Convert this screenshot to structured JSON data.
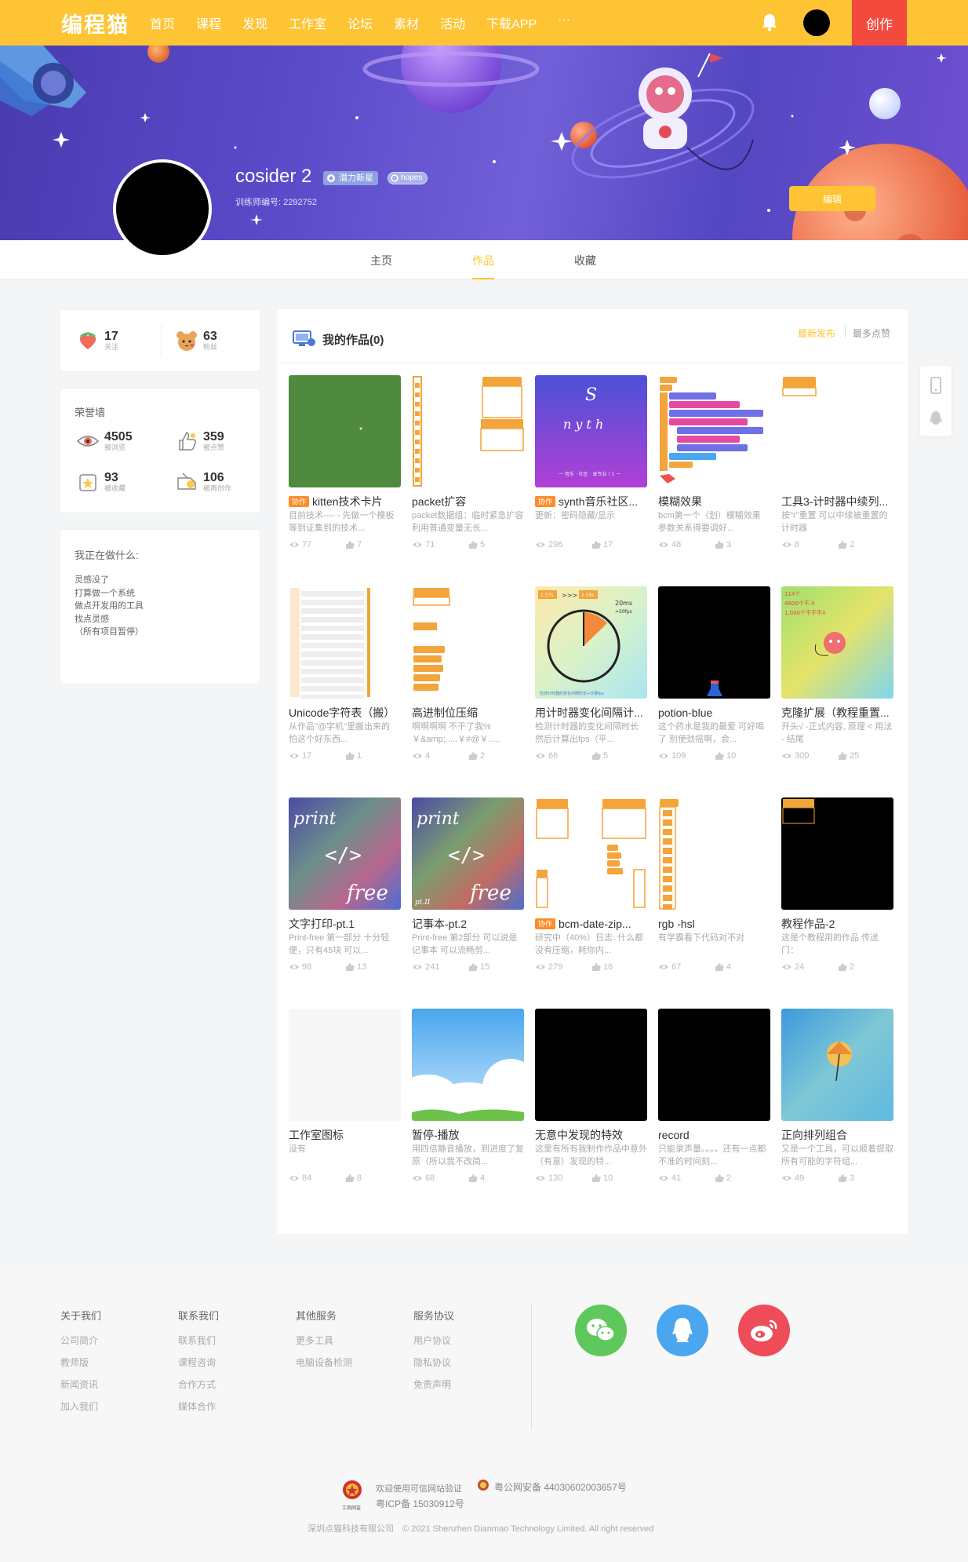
{
  "nav": {
    "logo": "编程猫",
    "links": [
      "首页",
      "课程",
      "发现",
      "工作室",
      "论坛",
      "素材",
      "活动",
      "下载APP",
      "···"
    ],
    "create": "创作",
    "bell_icon": "bell-icon"
  },
  "profile": {
    "name": "cosider 2",
    "badge": "潜力新星",
    "badge2": "hopes",
    "id_label": "训练师编号: 2292752",
    "edit": "编辑"
  },
  "tabs": [
    "主页",
    "作品",
    "收藏"
  ],
  "active_tab": "作品",
  "stats": {
    "follow": {
      "num": "17",
      "label": "关注"
    },
    "fans": {
      "num": "63",
      "label": "粉丝"
    }
  },
  "honor": {
    "title": "荣誉墙",
    "items": [
      {
        "num": "4505",
        "label": "被浏览"
      },
      {
        "num": "359",
        "label": "被点赞"
      },
      {
        "num": "93",
        "label": "被收藏"
      },
      {
        "num": "106",
        "label": "被再创作"
      }
    ]
  },
  "doing": {
    "title": "我正在做什么:",
    "text": "灵感没了\n打算做一个系统\n做点开发用的工具\n找点灵感\n（所有项目暂停）"
  },
  "works": {
    "title": "我的作品(0)",
    "sort_new": "最新发布",
    "sort_hot": "最多点赞",
    "items": [
      {
        "title": "kitten技术卡片",
        "tag": "协作",
        "desc": "目前技术---- - 先做一个模板 等到证集到的技术...",
        "views": "77",
        "likes": "7"
      },
      {
        "title": "packet扩容",
        "tag": "",
        "desc": "packet数据组：临时紧急扩容 利用普通变量无长...",
        "views": "71",
        "likes": "5"
      },
      {
        "title": "synth音乐社区...",
        "tag": "协作",
        "desc": "更新：密码隐藏/显示",
        "views": "296",
        "likes": "17"
      },
      {
        "title": "模糊效果",
        "tag": "",
        "desc": "bcm第一个（划）模糊效果 参数关系得要调好...",
        "views": "48",
        "likes": "3"
      },
      {
        "title": "工具3-计时器中续列...",
        "tag": "",
        "desc": "按\"r\"重置 可以中续被重置的计时器",
        "views": "8",
        "likes": "2"
      },
      {
        "title": "Unicode字符表（搬）",
        "tag": "",
        "desc": "从作品\"@字机\"里搬出来的 怕这个好东西...",
        "views": "17",
        "likes": "1"
      },
      {
        "title": "高进制位压缩",
        "tag": "",
        "desc": "啊啊啊啊 不干了我% ￥&amp;.....￥#@￥.....",
        "views": "4",
        "likes": "2"
      },
      {
        "title": "用计时器变化间隔计...",
        "tag": "",
        "desc": "检测计时器的变化间隔时长 然后计算出fps（平...",
        "views": "66",
        "likes": "5"
      },
      {
        "title": "potion-blue",
        "tag": "",
        "desc": "这个药水是我的最爱 可好喝了 别使劲摇啊，会...",
        "views": "109",
        "likes": "10"
      },
      {
        "title": "克隆扩展（教程重置...",
        "tag": "",
        "desc": "开头√ -正式内容, 原理 < 用法 - 结尾",
        "views": "300",
        "likes": "25"
      },
      {
        "title": "文字打印-pt.1",
        "tag": "",
        "desc": "Print-free 第一部分 十分轻便，只有45块 可以...",
        "views": "98",
        "likes": "13"
      },
      {
        "title": "记事本-pt.2",
        "tag": "",
        "desc": "Print-free 第2部分 可以说是记事本 可以流畅剪...",
        "views": "241",
        "likes": "15"
      },
      {
        "title": "bcm-date-zip...",
        "tag": "协作",
        "desc": "研究中（40%）日志: 什么都没有压缩，耗你内...",
        "views": "279",
        "likes": "16"
      },
      {
        "title": "rgb -hsl",
        "tag": "",
        "desc": "有学霸看下代码对不对",
        "views": "67",
        "likes": "4"
      },
      {
        "title": "教程作品-2",
        "tag": "",
        "desc": "这是个教程用的作品 传送门：",
        "views": "24",
        "likes": "2"
      },
      {
        "title": "工作室图标",
        "tag": "",
        "desc": "没有",
        "views": "84",
        "likes": "8"
      },
      {
        "title": "暂停-播放",
        "tag": "",
        "desc": "用四倍静音播放，到进度了复原（所以我不改简...",
        "views": "68",
        "likes": "4"
      },
      {
        "title": "无意中发现的特效",
        "tag": "",
        "desc": "这里有所有我制作作品中意外（有意）发现的特...",
        "views": "130",
        "likes": "10"
      },
      {
        "title": "record",
        "tag": "",
        "desc": "只能录声量。。。。还有一点都不准的时间刻...",
        "views": "41",
        "likes": "2"
      },
      {
        "title": "正向排列组合",
        "tag": "",
        "desc": "又是一个工具，可以顺着提取所有可能的字符组...",
        "views": "49",
        "likes": "3"
      }
    ],
    "thumb_text": {
      "synth_s": "S",
      "synth_nyth": "n y t h",
      "synth_sub": "一 音乐 · 社区 · 录专业 ! 1 一",
      "print": "print",
      "free": "free",
      "ptii": "pt.II",
      "timer_a": "1.57s",
      "timer_arrows": ">>>",
      "timer_b": "1.59s",
      "timer_ms": "20ms",
      "timer_fps": "=50fps",
      "timer_note": "检测计时器的变化间隔时长+计算fps",
      "clone_line1": "114个",
      "clone_line2": "4800个不 X",
      "clone_line3": "1,000个不不不X"
    }
  },
  "footer": {
    "cols": [
      {
        "head": "关于我们",
        "links": [
          "公司简介",
          "教师版",
          "新闻资讯",
          "加入我们"
        ]
      },
      {
        "head": "联系我们",
        "links": [
          "联系我们",
          "课程咨询",
          "合作方式",
          "媒体合作"
        ]
      },
      {
        "head": "其他服务",
        "links": [
          "更多工具",
          "电脑设备检测"
        ]
      },
      {
        "head": "服务协议",
        "links": [
          "用户协议",
          "隐私协议",
          "免责声明"
        ]
      }
    ],
    "verify": "欢迎使用可信网站验证",
    "icp": "粤ICP备 15030912号",
    "police": "粤公网安备 44030602003657号",
    "copyright": "深圳点猫科技有限公司　© 2021 Shenzhen Dianmao Technology Limited. All right reserved",
    "seal_text": "工商网监"
  }
}
